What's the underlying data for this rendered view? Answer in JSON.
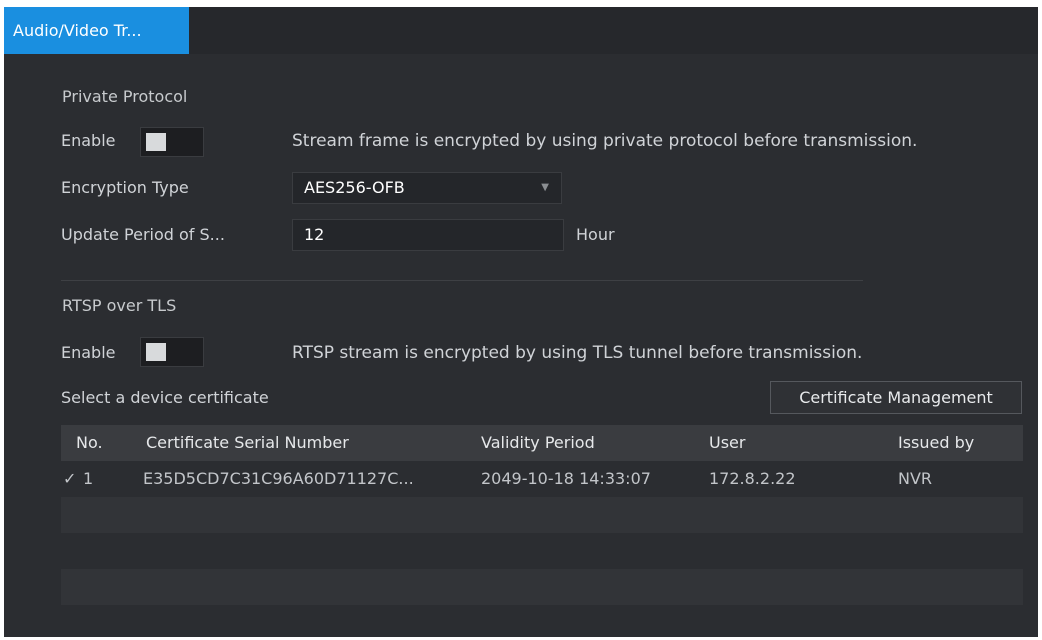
{
  "tab": {
    "label": "Audio/Video Tr..."
  },
  "private_protocol": {
    "title": "Private Protocol",
    "enable_label": "Enable",
    "enable_state": "off",
    "enable_desc": "Stream frame is encrypted by using private protocol before transmission.",
    "encryption_type_label": "Encryption Type",
    "encryption_type_value": "AES256-OFB",
    "update_period_label": "Update Period of S...",
    "update_period_value": "12",
    "update_period_unit": "Hour"
  },
  "rtsp": {
    "title": "RTSP over TLS",
    "enable_label": "Enable",
    "enable_state": "off",
    "enable_desc": "RTSP stream is encrypted by using TLS tunnel before transmission.",
    "select_cert_label": "Select a device certificate",
    "cert_mgmt_button": "Certificate Management"
  },
  "table": {
    "headers": {
      "no": "No.",
      "serial": "Certificate Serial Number",
      "validity": "Validity Period",
      "user": "User",
      "issued_by": "Issued by"
    },
    "rows": [
      {
        "checked": true,
        "no": "1",
        "serial": "E35D5CD7C31C96A60D71127C...",
        "validity": "2049-10-18 14:33:07",
        "user": "172.8.2.22",
        "issued_by": "NVR"
      }
    ]
  },
  "colors": {
    "tab_active": "#1a8fe0",
    "background": "#2b2d31"
  }
}
